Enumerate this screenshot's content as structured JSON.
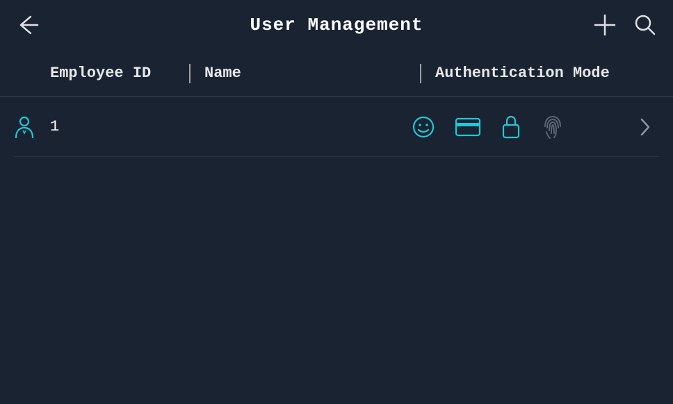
{
  "header": {
    "title": "User Management"
  },
  "columns": {
    "employee_id": "Employee ID",
    "name": "Name",
    "auth_mode": "Authentication Mode"
  },
  "users": [
    {
      "employee_id": "1",
      "name": "",
      "auth": {
        "face": true,
        "card": true,
        "password": true,
        "fingerprint": false
      }
    }
  ],
  "colors": {
    "accent": "#1fc9d6",
    "inactive": "#5a6570",
    "text": "#e0e0e0",
    "bg": "#1a2332"
  }
}
